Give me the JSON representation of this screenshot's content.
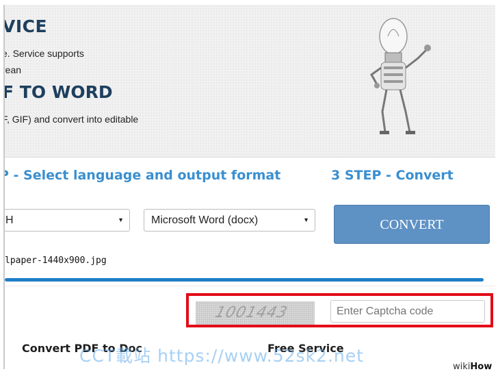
{
  "hero": {
    "title": "VICE",
    "line1": "e. Service supports",
    "line2": "rean",
    "subtitle": "F TO WORD",
    "line3": "F, GIF) and convert into editable"
  },
  "steps": {
    "step2_title": "P - Select language and output format",
    "step3_title": "3 STEP - Convert"
  },
  "form": {
    "language_value": "H",
    "format_value": "Microsoft Word (docx)",
    "convert_label": "CONVERT",
    "filename": "lpaper-1440x900.jpg",
    "progress_fraction": 1.0
  },
  "captcha": {
    "image_text": "1001443",
    "input_placeholder": "Enter Captcha code"
  },
  "bottom": {
    "heading_left": "Convert PDF to Doc",
    "heading_right": "Free Service"
  },
  "watermark": "CCT載站 https://www.52sk2.net",
  "branding": {
    "prefix": "wiki",
    "suffix": "How"
  },
  "colors": {
    "accent": "#3a8fd0",
    "title": "#1e3f5e",
    "button": "#5e91c4",
    "highlight": "#e20b17",
    "progress": "#1f7fc7"
  }
}
